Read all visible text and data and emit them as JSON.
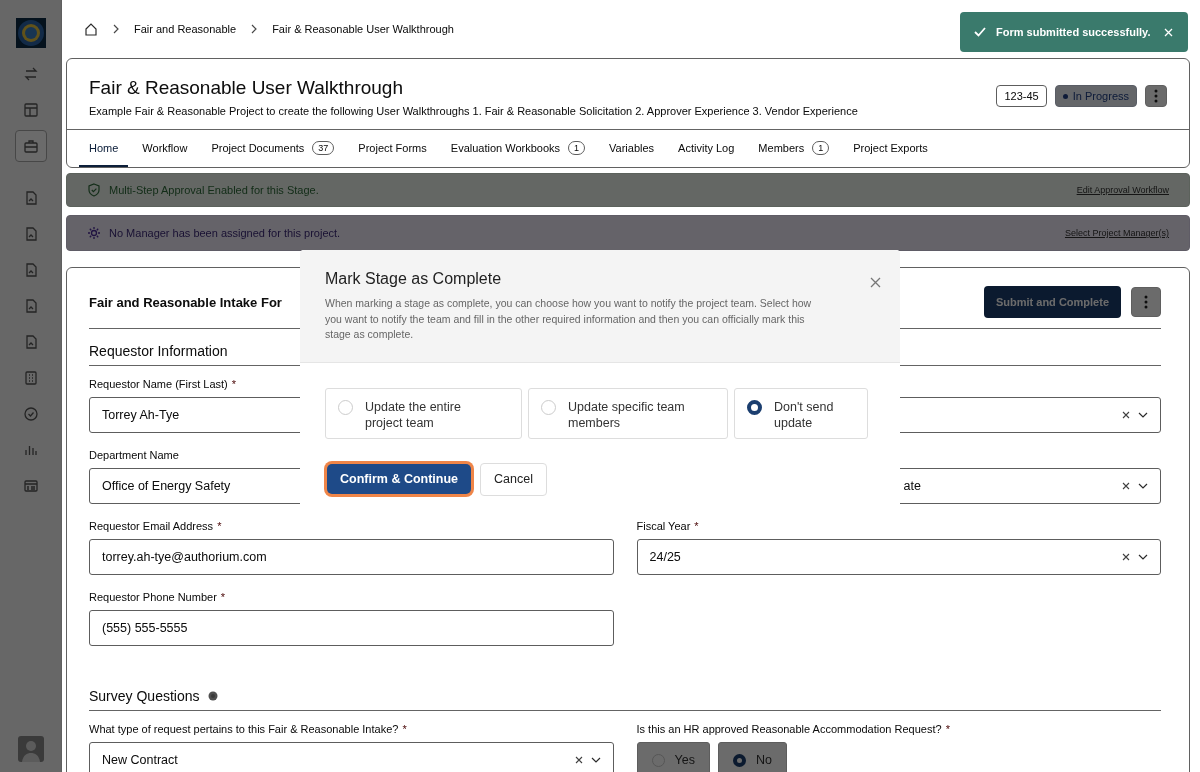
{
  "sidebar": {
    "items": [
      {
        "kind": "swap",
        "selected": false
      },
      {
        "kind": "layout",
        "selected": false
      },
      {
        "kind": "briefcase",
        "selected": true
      },
      {
        "kind": "document",
        "selected": false
      },
      {
        "kind": "document",
        "selected": false
      },
      {
        "kind": "document",
        "selected": false
      },
      {
        "kind": "document",
        "selected": false
      },
      {
        "kind": "document",
        "selected": false
      },
      {
        "kind": "calculator",
        "selected": false
      },
      {
        "kind": "check",
        "selected": false
      },
      {
        "kind": "chart",
        "selected": false
      },
      {
        "kind": "list",
        "selected": false
      }
    ]
  },
  "breadcrumb": [
    "Fair and Reasonable",
    "Fair & Reasonable User Walkthrough"
  ],
  "project": {
    "title": "Fair & Reasonable User Walkthrough",
    "description": "Example Fair & Reasonable Project to create the following User Walkthroughs 1. Fair & Reasonable Solicitation 2. Approver Experience 3. Vendor Experience",
    "code": "123-45",
    "status": "In Progress"
  },
  "tabs": [
    {
      "label": "Home",
      "selected": true
    },
    {
      "label": "Workflow",
      "selected": false
    },
    {
      "label": "Project Documents",
      "count": "37",
      "selected": false
    },
    {
      "label": "Project Forms",
      "selected": false
    },
    {
      "label": "Evaluation Workbooks",
      "count": "1",
      "selected": false
    },
    {
      "label": "Variables",
      "selected": false
    },
    {
      "label": "Activity Log",
      "selected": false
    },
    {
      "label": "Members",
      "count": "1",
      "selected": false
    },
    {
      "label": "Project Exports",
      "selected": false
    }
  ],
  "banners": [
    {
      "kind": "approval",
      "text": "Multi-Step Approval Enabled for this Stage.",
      "link": "Edit Approval Workflow"
    },
    {
      "kind": "manager",
      "text": "No Manager has been assigned for this project.",
      "link": "Select Project Manager(s)"
    }
  ],
  "form": {
    "title": "Fair and Reasonable Intake For",
    "submit": "Submit and Complete",
    "sections": [
      {
        "title": "Requestor Information",
        "info": false,
        "fields": [
          {
            "kind": "text",
            "label": "Requestor Name (First Last)",
            "required": true,
            "required_mark": "*",
            "value": "Torrey Ah-Tye"
          },
          {
            "kind": "select"
          },
          {
            "kind": "text",
            "label": "Department Name",
            "value": "Office of Energy Safety"
          },
          {
            "kind": "select",
            "value": "ate",
            "partly_hidden": true
          },
          {
            "kind": "text",
            "label": "Requestor Email Address",
            "required": true,
            "required_mark": "*",
            "value": "torrey.ah-tye@authorium.com"
          },
          {
            "kind": "select",
            "label": "Fiscal Year",
            "required": true,
            "required_mark": "*",
            "value": "24/25",
            "partly_hidden": false
          },
          {
            "kind": "text",
            "label": "Requestor Phone Number",
            "required": true,
            "required_mark": "*",
            "value": "(555) 555-5555"
          }
        ]
      },
      {
        "title": "Survey Questions",
        "info": true,
        "fields": [
          {
            "kind": "select",
            "label": "What type of request pertains to this Fair & Reasonable Intake?",
            "required": true,
            "required_mark": "*",
            "value": "New Contract",
            "partly_hidden": false
          },
          {
            "kind": "radio",
            "label": "Is this an HR approved Reasonable Accommodation Request?",
            "required": true,
            "required_mark": "*",
            "options": [
              {
                "label": "Yes",
                "selected": false
              },
              {
                "label": "No",
                "selected": true
              }
            ]
          }
        ]
      }
    ]
  },
  "modal": {
    "title": "Mark Stage as Complete",
    "description": "When marking a stage as complete, you can choose how you want to notify the project team. Select how you want to notify the team and fill in the other required information and then you can officially mark this stage as complete.",
    "options": [
      {
        "label": "Update the entire project team",
        "selected": false
      },
      {
        "label": "Update specific team members",
        "selected": false
      },
      {
        "label": "Don't send update",
        "selected": true
      }
    ],
    "confirm": "Confirm & Continue",
    "cancel": "Cancel"
  },
  "toast": {
    "text": "Form submitted successfully."
  }
}
